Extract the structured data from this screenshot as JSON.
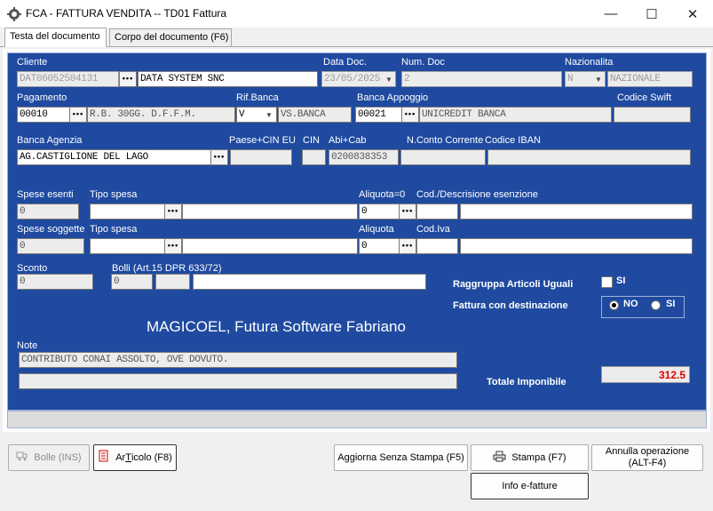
{
  "window": {
    "title": "FCA - FATTURA VENDITA  --  TD01 Fattura",
    "minimize": "—",
    "maximize": "☐",
    "close": "✕"
  },
  "tabs": [
    {
      "label": "Testa del documento",
      "active": true
    },
    {
      "label": "Corpo del documento (F6)",
      "active": false
    }
  ],
  "labels": {
    "cliente": "Cliente",
    "data_doc": "Data Doc.",
    "num_doc": "Num. Doc",
    "nazionalita": "Nazionalita",
    "pagamento": "Pagamento",
    "rif_banca": "Rif.Banca",
    "banca_appoggio": "Banca Appoggio",
    "codice_swift": "Codice Swift",
    "banca_agenzia": "Banca Agenzia",
    "paese_cin_eu": "Paese+CIN EU",
    "cin": "CIN",
    "abi_cab": "Abi+Cab",
    "n_conto": "N.Conto Corrente",
    "iban": "Codice IBAN",
    "spese_esenti": "Spese esenti",
    "tipo_spesa_1": "Tipo spesa",
    "aliquota_0": "Aliquota=0",
    "cod_descr_esenzione": "Cod./Descrisione esenzione",
    "spese_soggette": "Spese soggette",
    "tipo_spesa_2": "Tipo spesa",
    "aliquota": "Aliquota",
    "cod_iva": "Cod.Iva",
    "sconto": "Sconto",
    "bolli": "Bolli (Art.15 DPR 633/72)",
    "raggruppa": "Raggruppa Articoli Uguali",
    "raggruppa_si": "SI",
    "fattura_destinazione": "Fattura con destinazione",
    "dest_no": "NO",
    "dest_si": "SI",
    "note": "Note",
    "totale_imponibile": "Totale Imponibile"
  },
  "fields": {
    "cliente_code": "DAT06052504131",
    "cliente_name": "DATA SYSTEM SNC",
    "data_doc": "23/05/2025",
    "num_doc": "2",
    "nazionalita_code": "N",
    "nazionalita_name": "NAZIONALE",
    "pagamento_code": "00010",
    "pagamento_desc": "R.B. 30GG. D.F.F.M.",
    "rif_banca_code": "V",
    "rif_banca_desc": "VS.BANCA",
    "banca_appoggio_code": "00021",
    "banca_appoggio_name": "UNICREDIT BANCA",
    "codice_swift": "",
    "banca_agenzia": "AG.CASTIGLIONE DEL LAGO",
    "paese_cin_eu": "",
    "cin": "",
    "abi_cab": "0200838353",
    "n_conto": "",
    "iban": "",
    "spese_esenti": "0",
    "tipo_spesa_1": "",
    "tipo_spesa_1_desc": "",
    "aliquota_0": "0",
    "cod_esenzione": "",
    "descr_esenzione": "",
    "spese_soggette": "0",
    "tipo_spesa_2": "",
    "tipo_spesa_2_desc": "",
    "aliquota": "0",
    "cod_iva": "",
    "cod_iva_desc": "",
    "sconto": "0",
    "bolli_1": "0",
    "bolli_2": "",
    "bolli_3": "",
    "note_1": "CONTRIBUTO CONAI ASSOLTO, OVE DOVUTO.",
    "note_2": "",
    "totale_imponibile": "312.5"
  },
  "state": {
    "raggruppa_checked": false,
    "destinazione": "NO"
  },
  "brand": "MAGICOEL, Futura Software Fabriano",
  "buttons": {
    "bolle": "Bolle  (INS)",
    "articolo_prefix": "Ar",
    "articolo_underline": "T",
    "articolo_suffix": "icolo (F8)",
    "aggiorna": "Aggiorna Senza Stampa (F5)",
    "stampa": "Stampa  (F7)",
    "annulla_line1": "Annulla operazione",
    "annulla_line2": "(ALT-F4)",
    "info": "Info e-fatture"
  },
  "icons": {
    "app": "gear-app-icon",
    "bolle": "truck-icon",
    "articolo": "article-icon",
    "stampa": "printer-icon"
  }
}
